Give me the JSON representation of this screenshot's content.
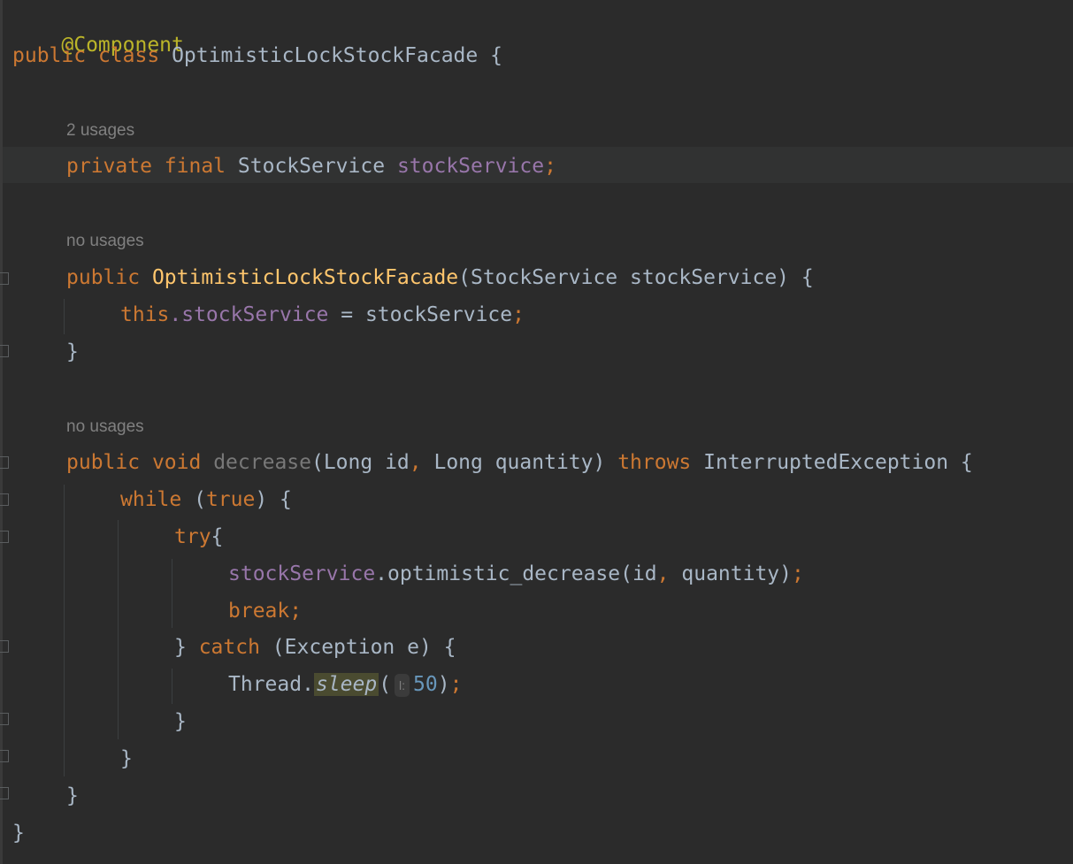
{
  "editor": {
    "annotation": "@Component",
    "class_decl": {
      "kw_public": "public",
      "kw_class": "class",
      "name": "OptimisticLockStockFacade",
      "brace": "{"
    },
    "field_usages": "2 usages",
    "field_decl": {
      "kw_private": "private",
      "kw_final": "final",
      "type": "StockService",
      "name": "stockService",
      "semi": ";"
    },
    "ctor_usages": "no usages",
    "ctor_decl": {
      "kw_public": "public",
      "name": "OptimisticLockStockFacade",
      "params": "(StockService stockService) {"
    },
    "ctor_body": {
      "kw_this": "this",
      "field": ".stockService",
      "rest": " = stockService",
      "semi": ";"
    },
    "ctor_close": "}",
    "method_usages": "no usages",
    "method_decl": {
      "kw_public": "public",
      "kw_void": "void",
      "name": "decrease",
      "paren_open": "(Long id",
      "comma": ",",
      "params_rest": " Long quantity) ",
      "kw_throws": "throws",
      "exception": " InterruptedException {"
    },
    "while_line": {
      "kw_while": "while",
      "open": " (",
      "kw_true": "true",
      "close": ") {"
    },
    "try_line": {
      "kw_try": "try",
      "brace": "{"
    },
    "call_line": {
      "field": "stockService",
      "call": ".optimistic_decrease(id",
      "comma": ",",
      "rest": " quantity)",
      "semi": ";"
    },
    "break_line": {
      "kw_break": "break",
      "semi": ";"
    },
    "catch_line": {
      "close": "} ",
      "kw_catch": "catch",
      "rest": " (Exception e) {"
    },
    "sleep_line": {
      "cls": "Thread.",
      "method": "sleep",
      "open": "(",
      "param_hint": "l:",
      "number": "50",
      "close": ")",
      "semi": ";"
    },
    "catch_close": "}",
    "while_close": "}",
    "method_close": "}",
    "class_close": "}"
  }
}
